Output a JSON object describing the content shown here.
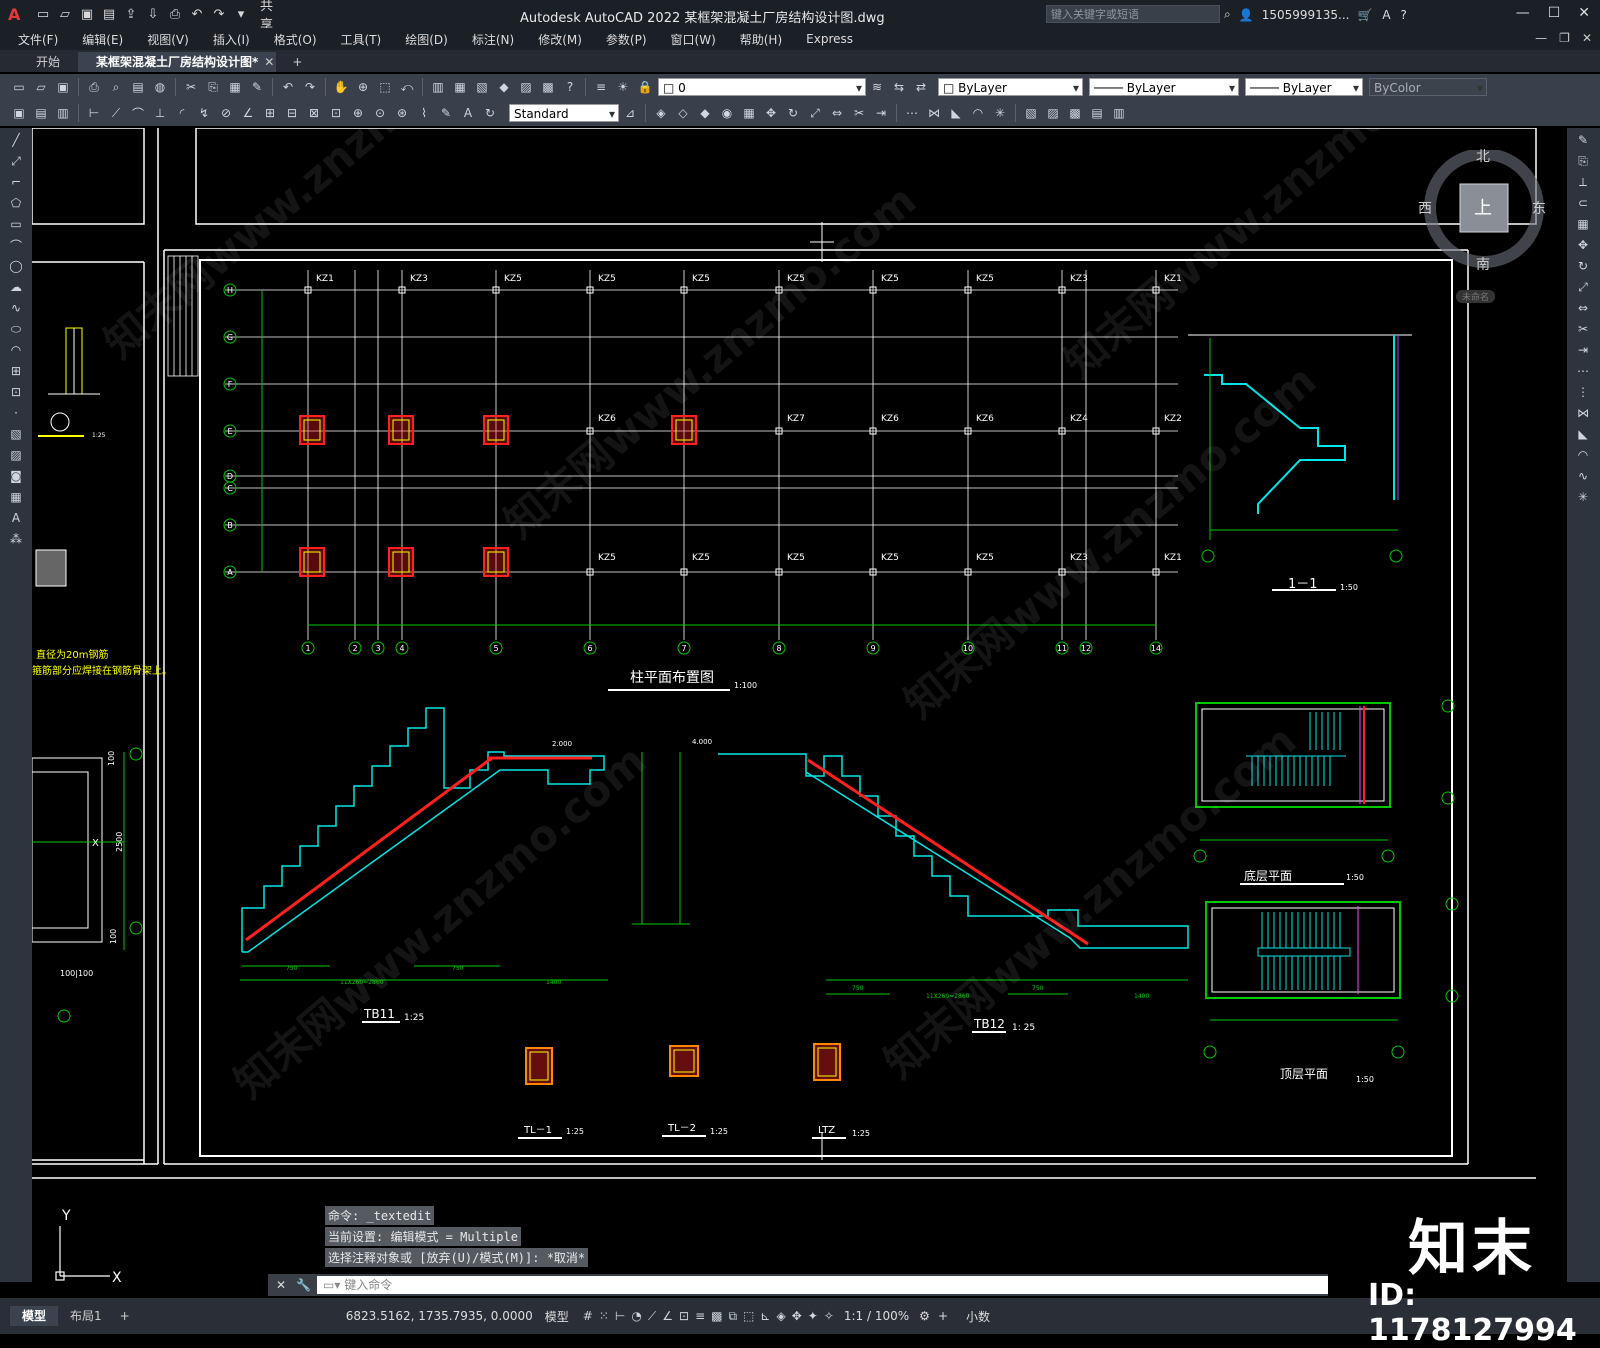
{
  "app": {
    "logo": "A",
    "title": "Autodesk AutoCAD 2022    某框架混凝土厂房结构设计图.dwg",
    "share_label": "共享",
    "search_placeholder": "键入关键字或短语",
    "user": "1505999135...",
    "colors": {
      "accent": "#e03a3a",
      "cad_green": "#00c800",
      "cad_cyan": "#00e5e5",
      "cad_red": "#ff2020",
      "cad_yellow": "#ffff00",
      "cad_white": "#ffffff"
    }
  },
  "menu": [
    "文件(F)",
    "编辑(E)",
    "视图(V)",
    "插入(I)",
    "格式(O)",
    "工具(T)",
    "绘图(D)",
    "标注(N)",
    "修改(M)",
    "参数(P)",
    "窗口(W)",
    "帮助(H)",
    "Express"
  ],
  "tabs": {
    "start": "开始",
    "file": "某框架混凝土厂房结构设计图*",
    "add": "+"
  },
  "toolbar": {
    "layer_value": "0",
    "color": "ByLayer",
    "linetype": "ByLayer",
    "lineweight": "ByLayer",
    "plotstyle": "ByColor",
    "text_style": "Standard"
  },
  "viewcube": {
    "north": "北",
    "south": "南",
    "east": "东",
    "west": "西",
    "top": "上",
    "wcs": "未命名"
  },
  "drawing": {
    "column_plan_title": "柱平面布置图",
    "column_plan_scale": "1:100",
    "axis_rows": [
      "H",
      "G",
      "F",
      "E",
      "D",
      "C",
      "B",
      "A"
    ],
    "axis_cols": [
      "1",
      "2",
      "3",
      "4",
      "5",
      "6",
      "7",
      "8",
      "9",
      "10",
      "11",
      "12",
      "14"
    ],
    "top_labels": [
      "KZ1",
      "KZ3",
      "KZ5",
      "KZ5",
      "KZ5",
      "KZ5",
      "KZ5",
      "KZ5",
      "KZ3",
      "KZ1"
    ],
    "mid_labels": [
      "KZ6",
      "KZ7",
      "KZ6",
      "KZ6",
      "KZ4",
      "KZ2"
    ],
    "bot_labels": [
      "KZ5",
      "KZ5",
      "KZ5",
      "KZ5",
      "KZ5",
      "KZ3",
      "KZ1"
    ],
    "section_title": "1－1",
    "section_scale": "1:50",
    "ground_plan_title": "底层平面",
    "ground_plan_scale": "1:50",
    "top_plan_title": "顶层平面",
    "top_plan_scale": "1:50",
    "tb11_title": "TB11",
    "tb11_scale": "1:25",
    "tb12_title": "TB12",
    "tb12_scale": "1: 25",
    "tl1_title": "TL－1",
    "tl1_scale": "1:25",
    "tl2_title": "TL－2",
    "tl2_scale": "1:25",
    "ltz_title": "LTZ",
    "ltz_scale": "1:25",
    "elev_left": "2.000",
    "elev_right": "4.000",
    "note_line1": "直径为20m钢筋",
    "note_line2": "箍筋部分应焊接在钢筋骨架上。",
    "dim_left_a": "100",
    "dim_left_b": "2500",
    "dim_left_c": "100",
    "dim_left_d": "100|100",
    "x_label": "X",
    "y_label": "Y",
    "detail_scale_left": "1:25",
    "tb11_dims": [
      "750",
      "11X260=2860",
      "750",
      "1400"
    ],
    "tb12_dims": [
      "750",
      "11X260=2860",
      "750",
      "1400"
    ]
  },
  "command": {
    "history": [
      "命令: _textedit",
      "当前设置: 编辑模式 = Multiple",
      "选择注释对象或 [放弃(U)/模式(M)]: *取消*"
    ],
    "placeholder": "键入命令"
  },
  "status": {
    "tab_model": "模型",
    "tab_layout": "布局1",
    "tab_add": "+",
    "coords": "6823.5162, 1735.7935, 0.0000",
    "space": "模型",
    "scale": "1:1 / 100%",
    "units": "小数"
  },
  "watermark": {
    "logo": "知末",
    "id": "ID: 1178127994"
  }
}
